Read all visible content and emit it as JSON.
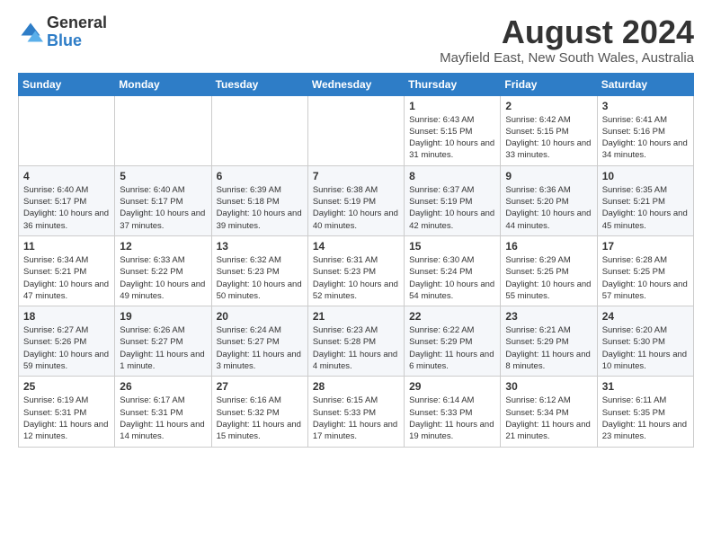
{
  "logo": {
    "general": "General",
    "blue": "Blue"
  },
  "header": {
    "month_year": "August 2024",
    "location": "Mayfield East, New South Wales, Australia"
  },
  "days_of_week": [
    "Sunday",
    "Monday",
    "Tuesday",
    "Wednesday",
    "Thursday",
    "Friday",
    "Saturday"
  ],
  "weeks": [
    [
      {
        "day": "",
        "info": ""
      },
      {
        "day": "",
        "info": ""
      },
      {
        "day": "",
        "info": ""
      },
      {
        "day": "",
        "info": ""
      },
      {
        "day": "1",
        "info": "Sunrise: 6:43 AM\nSunset: 5:15 PM\nDaylight: 10 hours and 31 minutes."
      },
      {
        "day": "2",
        "info": "Sunrise: 6:42 AM\nSunset: 5:15 PM\nDaylight: 10 hours and 33 minutes."
      },
      {
        "day": "3",
        "info": "Sunrise: 6:41 AM\nSunset: 5:16 PM\nDaylight: 10 hours and 34 minutes."
      }
    ],
    [
      {
        "day": "4",
        "info": "Sunrise: 6:40 AM\nSunset: 5:17 PM\nDaylight: 10 hours and 36 minutes."
      },
      {
        "day": "5",
        "info": "Sunrise: 6:40 AM\nSunset: 5:17 PM\nDaylight: 10 hours and 37 minutes."
      },
      {
        "day": "6",
        "info": "Sunrise: 6:39 AM\nSunset: 5:18 PM\nDaylight: 10 hours and 39 minutes."
      },
      {
        "day": "7",
        "info": "Sunrise: 6:38 AM\nSunset: 5:19 PM\nDaylight: 10 hours and 40 minutes."
      },
      {
        "day": "8",
        "info": "Sunrise: 6:37 AM\nSunset: 5:19 PM\nDaylight: 10 hours and 42 minutes."
      },
      {
        "day": "9",
        "info": "Sunrise: 6:36 AM\nSunset: 5:20 PM\nDaylight: 10 hours and 44 minutes."
      },
      {
        "day": "10",
        "info": "Sunrise: 6:35 AM\nSunset: 5:21 PM\nDaylight: 10 hours and 45 minutes."
      }
    ],
    [
      {
        "day": "11",
        "info": "Sunrise: 6:34 AM\nSunset: 5:21 PM\nDaylight: 10 hours and 47 minutes."
      },
      {
        "day": "12",
        "info": "Sunrise: 6:33 AM\nSunset: 5:22 PM\nDaylight: 10 hours and 49 minutes."
      },
      {
        "day": "13",
        "info": "Sunrise: 6:32 AM\nSunset: 5:23 PM\nDaylight: 10 hours and 50 minutes."
      },
      {
        "day": "14",
        "info": "Sunrise: 6:31 AM\nSunset: 5:23 PM\nDaylight: 10 hours and 52 minutes."
      },
      {
        "day": "15",
        "info": "Sunrise: 6:30 AM\nSunset: 5:24 PM\nDaylight: 10 hours and 54 minutes."
      },
      {
        "day": "16",
        "info": "Sunrise: 6:29 AM\nSunset: 5:25 PM\nDaylight: 10 hours and 55 minutes."
      },
      {
        "day": "17",
        "info": "Sunrise: 6:28 AM\nSunset: 5:25 PM\nDaylight: 10 hours and 57 minutes."
      }
    ],
    [
      {
        "day": "18",
        "info": "Sunrise: 6:27 AM\nSunset: 5:26 PM\nDaylight: 10 hours and 59 minutes."
      },
      {
        "day": "19",
        "info": "Sunrise: 6:26 AM\nSunset: 5:27 PM\nDaylight: 11 hours and 1 minute."
      },
      {
        "day": "20",
        "info": "Sunrise: 6:24 AM\nSunset: 5:27 PM\nDaylight: 11 hours and 3 minutes."
      },
      {
        "day": "21",
        "info": "Sunrise: 6:23 AM\nSunset: 5:28 PM\nDaylight: 11 hours and 4 minutes."
      },
      {
        "day": "22",
        "info": "Sunrise: 6:22 AM\nSunset: 5:29 PM\nDaylight: 11 hours and 6 minutes."
      },
      {
        "day": "23",
        "info": "Sunrise: 6:21 AM\nSunset: 5:29 PM\nDaylight: 11 hours and 8 minutes."
      },
      {
        "day": "24",
        "info": "Sunrise: 6:20 AM\nSunset: 5:30 PM\nDaylight: 11 hours and 10 minutes."
      }
    ],
    [
      {
        "day": "25",
        "info": "Sunrise: 6:19 AM\nSunset: 5:31 PM\nDaylight: 11 hours and 12 minutes."
      },
      {
        "day": "26",
        "info": "Sunrise: 6:17 AM\nSunset: 5:31 PM\nDaylight: 11 hours and 14 minutes."
      },
      {
        "day": "27",
        "info": "Sunrise: 6:16 AM\nSunset: 5:32 PM\nDaylight: 11 hours and 15 minutes."
      },
      {
        "day": "28",
        "info": "Sunrise: 6:15 AM\nSunset: 5:33 PM\nDaylight: 11 hours and 17 minutes."
      },
      {
        "day": "29",
        "info": "Sunrise: 6:14 AM\nSunset: 5:33 PM\nDaylight: 11 hours and 19 minutes."
      },
      {
        "day": "30",
        "info": "Sunrise: 6:12 AM\nSunset: 5:34 PM\nDaylight: 11 hours and 21 minutes."
      },
      {
        "day": "31",
        "info": "Sunrise: 6:11 AM\nSunset: 5:35 PM\nDaylight: 11 hours and 23 minutes."
      }
    ]
  ]
}
